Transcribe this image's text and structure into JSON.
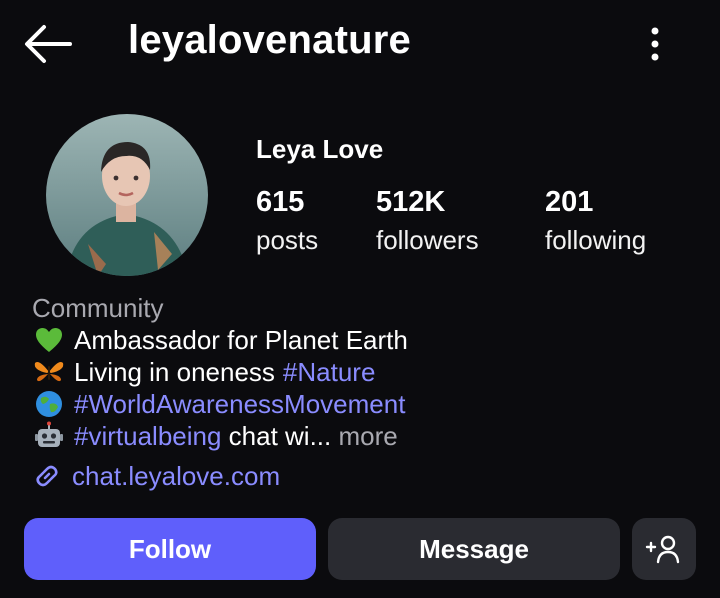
{
  "header": {
    "username": "leyalovenature",
    "back_icon": "arrow-left-icon",
    "menu_icon": "kebab-vertical-icon"
  },
  "profile": {
    "display_name": "Leya Love",
    "avatar_icon": "profile-avatar",
    "stats": [
      {
        "value": "615",
        "label": "posts"
      },
      {
        "value": "512K",
        "label": "followers"
      },
      {
        "value": "201",
        "label": "following"
      }
    ]
  },
  "bio": {
    "category": "Community",
    "lines": [
      {
        "emoji": "green-heart-icon",
        "text": "Ambassador for Planet Earth",
        "tag": ""
      },
      {
        "emoji": "butterfly-icon",
        "text": "Living in oneness ",
        "tag": "#Nature"
      },
      {
        "emoji": "globe-icon",
        "text": "",
        "tag": "#WorldAwarenessMovement"
      },
      {
        "emoji": "robot-icon",
        "text": "",
        "tag": "#virtualbeing",
        "after": " chat wi...",
        "more": " more"
      }
    ],
    "link": "chat.leyalove.com"
  },
  "actions": {
    "follow_label": "Follow",
    "message_label": "Message",
    "add_user_icon": "add-person-icon"
  },
  "colors": {
    "background": "#0b0b0e",
    "accent": "#5f5ffb",
    "link": "#8a8cff",
    "secondary_button": "#2a2b31",
    "muted_text": "#a9a9b0"
  }
}
